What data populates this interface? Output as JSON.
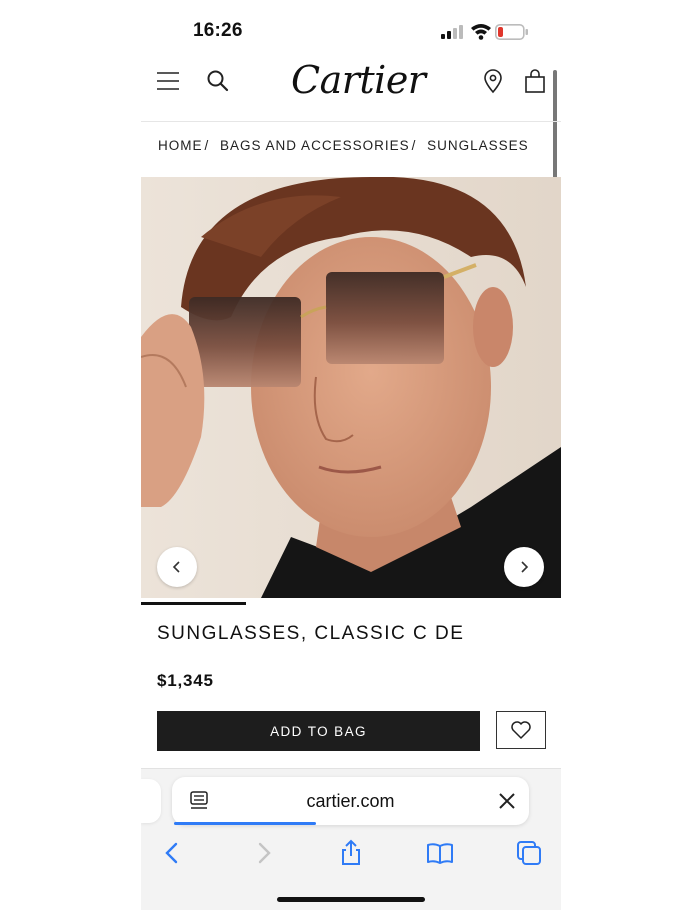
{
  "status_bar": {
    "time": "16:26"
  },
  "header": {
    "logo": "Cartier"
  },
  "breadcrumb": [
    {
      "label": "HOME"
    },
    {
      "label": "BAGS AND ACCESSORIES"
    },
    {
      "label": "SUNGLASSES"
    }
  ],
  "product": {
    "title": "SUNGLASSES, CLASSIC C DE",
    "price": "$1,345",
    "add_to_bag": "ADD TO BAG"
  },
  "carousel": {
    "progress": 0.25
  },
  "browser": {
    "url": "cartier.com",
    "load_progress": 0.4
  },
  "icons": {
    "header": [
      "menu-icon",
      "search-icon",
      "location-icon",
      "bag-icon"
    ],
    "toolbar": [
      "back-icon",
      "forward-icon",
      "share-icon",
      "bookmarks-icon",
      "tabs-icon"
    ]
  },
  "colors": {
    "button_bg": "#1d1d1d",
    "safari_accent": "#2f7bf6",
    "battery_low": "#e0362c"
  }
}
